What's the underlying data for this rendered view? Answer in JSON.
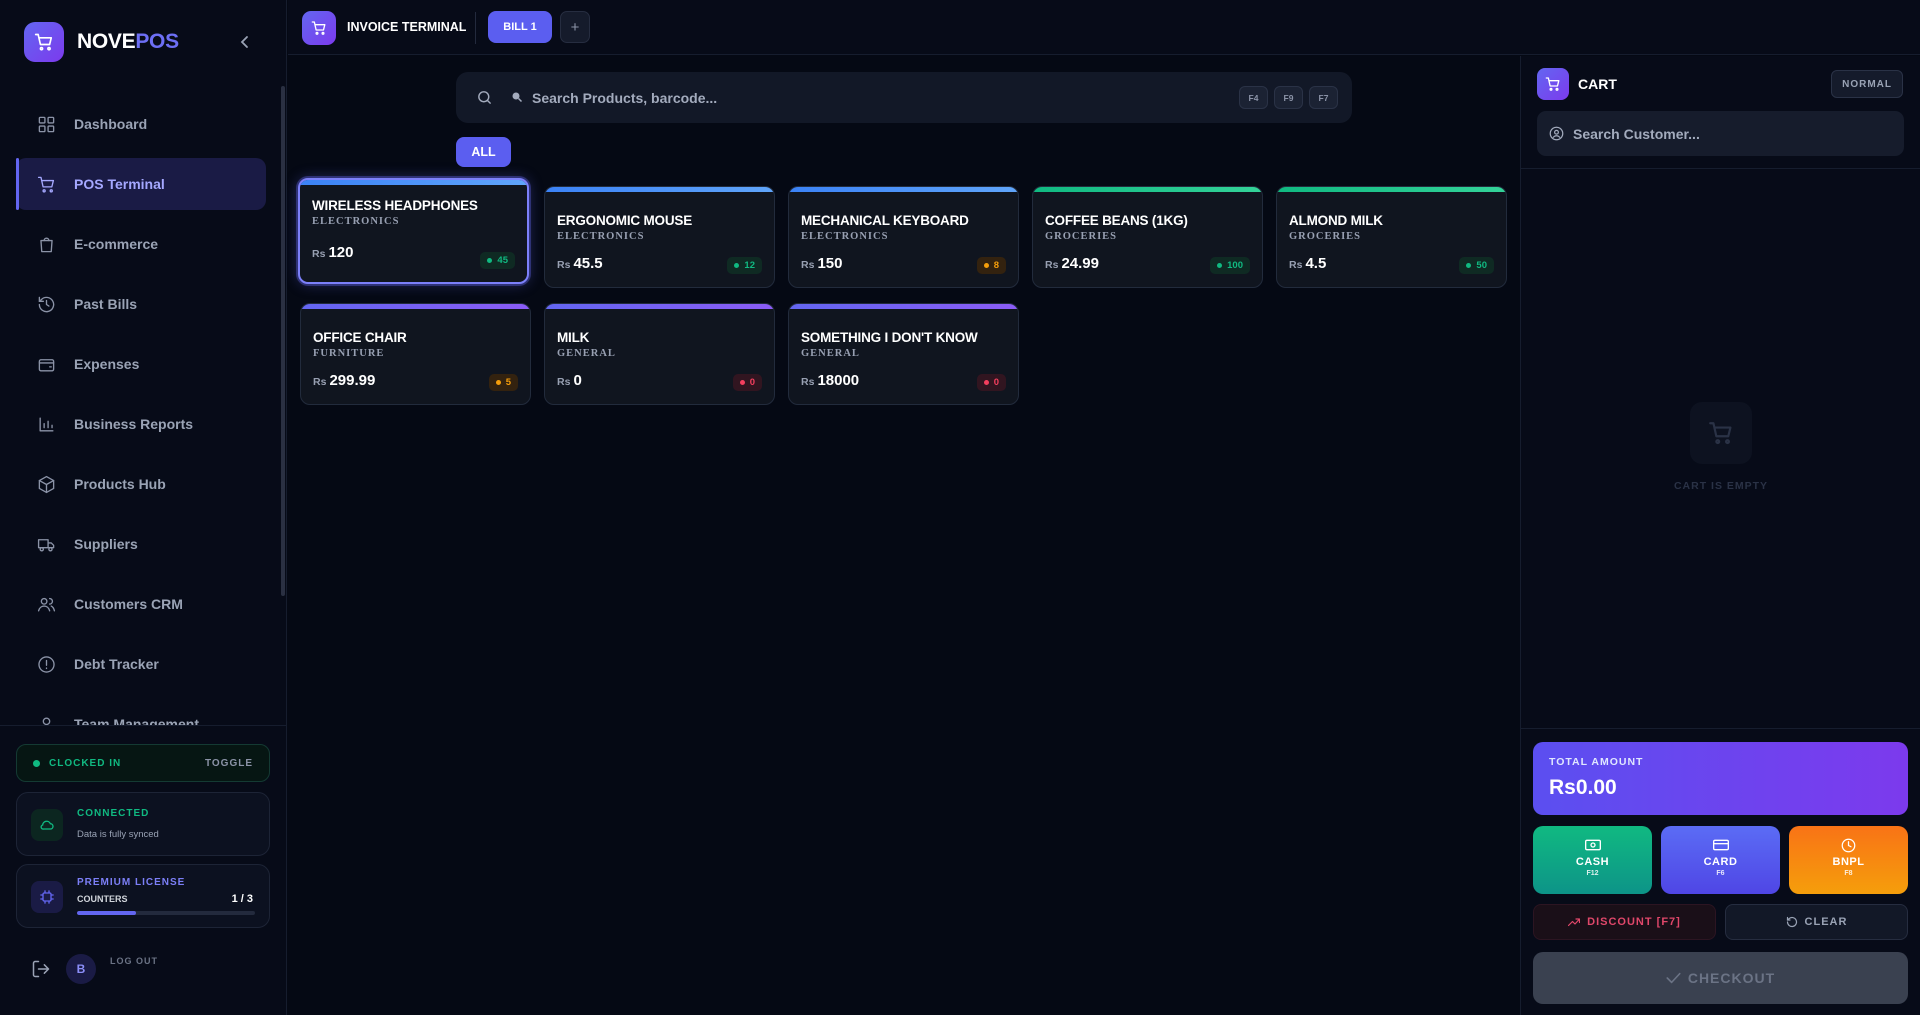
{
  "brand": {
    "name_part1": "NOVE",
    "name_part2": "POS"
  },
  "sidebar": {
    "items": [
      {
        "label": "Dashboard",
        "icon": "dashboard-icon",
        "active": false
      },
      {
        "label": "POS Terminal",
        "icon": "cart-icon",
        "active": true
      },
      {
        "label": "E-commerce",
        "icon": "shopping-bag-icon",
        "active": false
      },
      {
        "label": "Past Bills",
        "icon": "history-icon",
        "active": false
      },
      {
        "label": "Expenses",
        "icon": "wallet-icon",
        "active": false
      },
      {
        "label": "Business Reports",
        "icon": "bar-chart-icon",
        "active": false
      },
      {
        "label": "Products Hub",
        "icon": "package-icon",
        "active": false
      },
      {
        "label": "Suppliers",
        "icon": "truck-icon",
        "active": false
      },
      {
        "label": "Customers CRM",
        "icon": "users-icon",
        "active": false
      },
      {
        "label": "Debt Tracker",
        "icon": "alert-circle-icon",
        "active": false
      },
      {
        "label": "Team Management",
        "icon": "user-icon",
        "active": false
      }
    ],
    "clock": {
      "status": "CLOCKED IN",
      "toggle": "TOGGLE"
    },
    "connection": {
      "title": "CONNECTED",
      "subtitle": "Data is fully synced"
    },
    "license": {
      "title": "PREMIUM LICENSE",
      "label": "COUNTERS",
      "count": "1 / 3",
      "used_fraction": 0.33
    },
    "user": {
      "initial": "B",
      "logout_label": "LOG OUT"
    }
  },
  "topbar": {
    "title": "INVOICE TERMINAL",
    "bill_tab": "BILL 1",
    "add_label": "+"
  },
  "search": {
    "placeholder": "Search Products, barcode...",
    "keys": [
      "F4",
      "F9",
      "F7"
    ]
  },
  "categories": {
    "all": "ALL"
  },
  "products": [
    {
      "name": "WIRELESS HEADPHONES",
      "category": "ELECTRONICS",
      "currency": "Rs",
      "price": "120",
      "stock": "45",
      "stock_level": "green",
      "selected": true,
      "accent": [
        "#3b82f6",
        "#60a5fa"
      ]
    },
    {
      "name": "ERGONOMIC MOUSE",
      "category": "ELECTRONICS",
      "currency": "Rs",
      "price": "45.5",
      "stock": "12",
      "stock_level": "green",
      "selected": false,
      "accent": [
        "#3b82f6",
        "#60a5fa"
      ]
    },
    {
      "name": "MECHANICAL KEYBOARD",
      "category": "ELECTRONICS",
      "currency": "Rs",
      "price": "150",
      "stock": "8",
      "stock_level": "orange",
      "selected": false,
      "accent": [
        "#3b82f6",
        "#60a5fa"
      ]
    },
    {
      "name": "COFFEE BEANS (1KG)",
      "category": "GROCERIES",
      "currency": "Rs",
      "price": "24.99",
      "stock": "100",
      "stock_level": "green",
      "selected": false,
      "accent": [
        "#10b981",
        "#34d399"
      ]
    },
    {
      "name": "ALMOND MILK",
      "category": "GROCERIES",
      "currency": "Rs",
      "price": "4.5",
      "stock": "50",
      "stock_level": "green",
      "selected": false,
      "accent": [
        "#10b981",
        "#34d399"
      ]
    },
    {
      "name": "OFFICE CHAIR",
      "category": "FURNITURE",
      "currency": "Rs",
      "price": "299.99",
      "stock": "5",
      "stock_level": "orange",
      "selected": false,
      "accent": [
        "#6366f1",
        "#8b5cf6"
      ]
    },
    {
      "name": "MILK",
      "category": "GENERAL",
      "currency": "Rs",
      "price": "0",
      "stock": "0",
      "stock_level": "red",
      "selected": false,
      "accent": [
        "#6366f1",
        "#8b5cf6"
      ]
    },
    {
      "name": "SOMETHING I DON'T KNOW",
      "category": "GENERAL",
      "currency": "Rs",
      "price": "18000",
      "stock": "0",
      "stock_level": "red",
      "selected": false,
      "accent": [
        "#6366f1",
        "#8b5cf6"
      ]
    }
  ],
  "cart": {
    "title": "CART",
    "mode": "NORMAL",
    "customer_placeholder": "Search Customer...",
    "empty_text": "CART IS EMPTY",
    "total_label": "TOTAL AMOUNT",
    "total_value": "Rs0.00",
    "pay": {
      "cash": {
        "label": "CASH",
        "key": "F12"
      },
      "card": {
        "label": "CARD",
        "key": "F6"
      },
      "bnpl": {
        "label": "BNPL",
        "key": "F8"
      }
    },
    "discount": "DISCOUNT [F7]",
    "clear": "CLEAR",
    "checkout": "CHECKOUT"
  }
}
